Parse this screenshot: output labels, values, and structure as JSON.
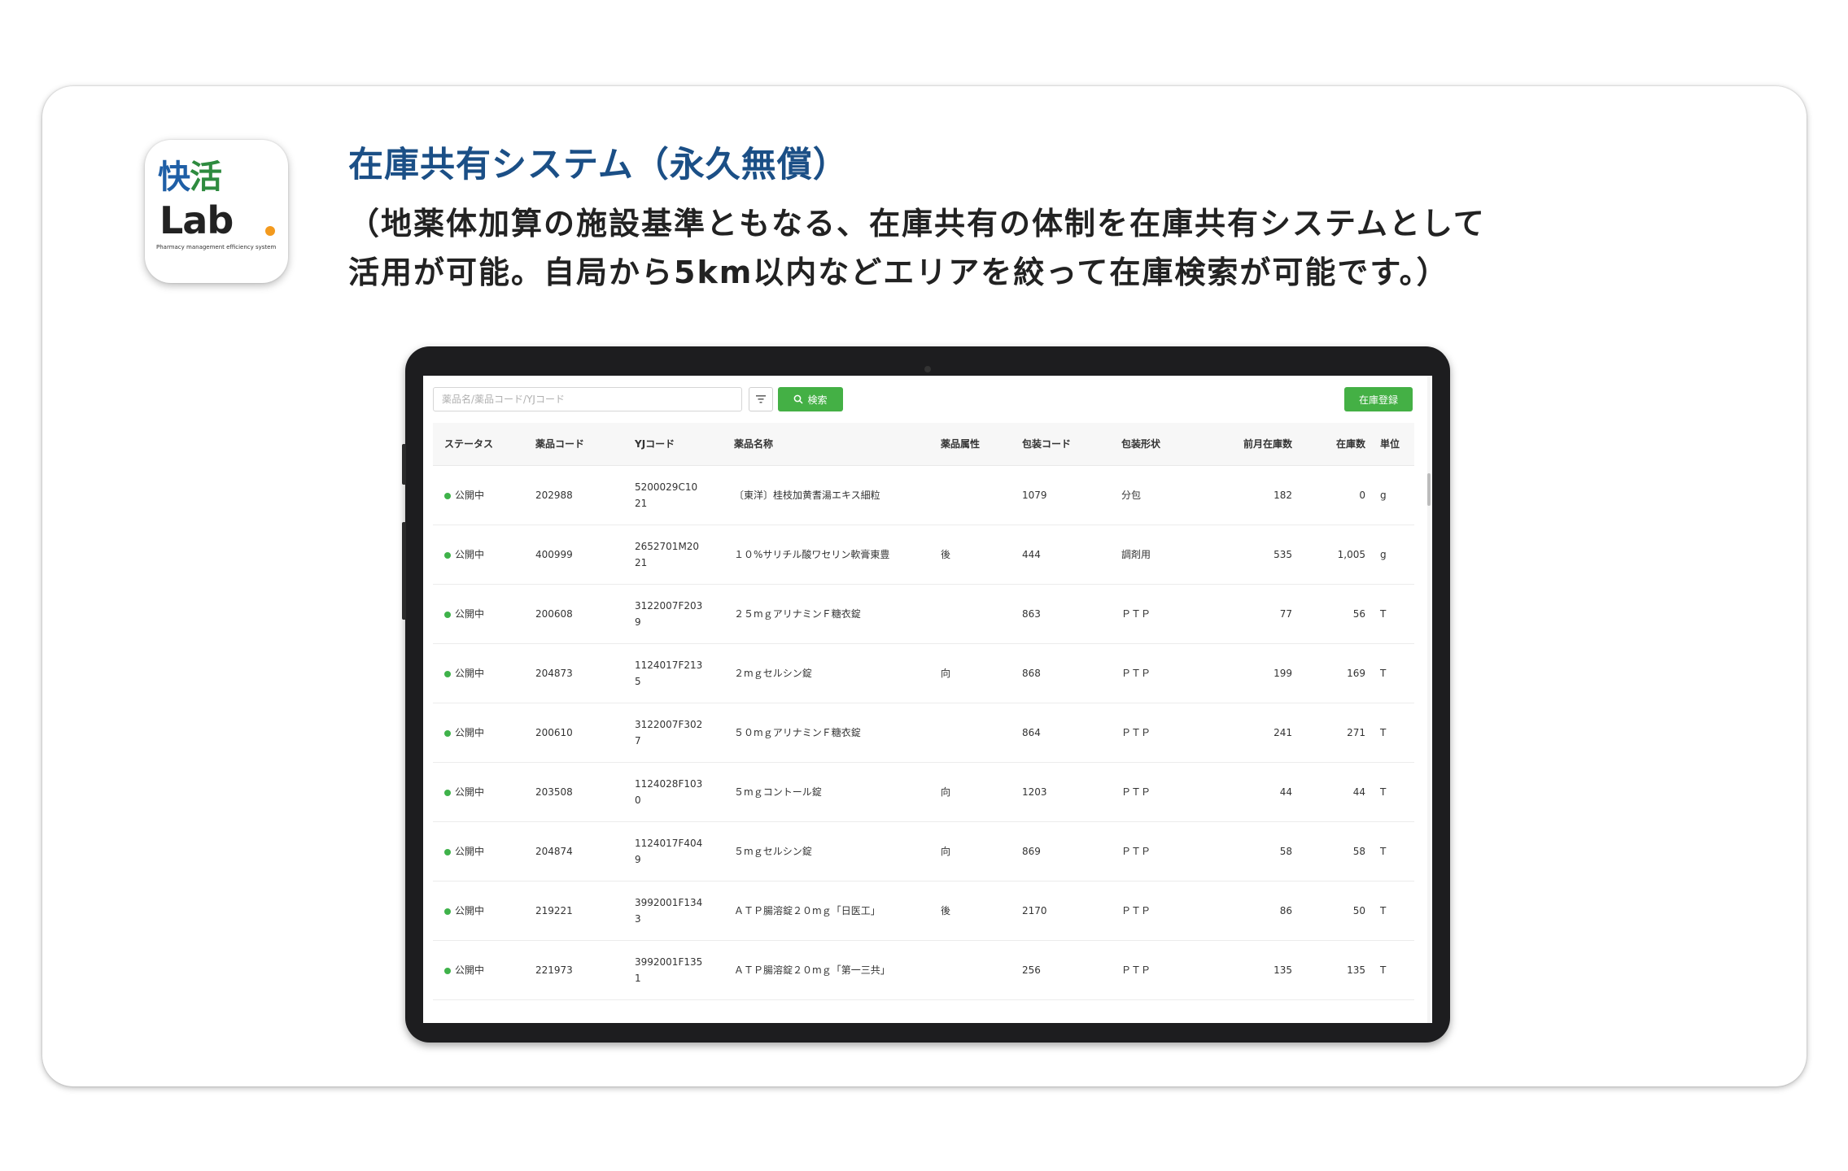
{
  "app": {
    "logo_kana_1": "快",
    "logo_kana_2": "活",
    "logo_lab": "Lab",
    "logo_tagline": "Pharmacy management efficiency system",
    "brand_colors": {
      "blue": "#1f5fa6",
      "green": "#2e8b3f",
      "orange": "#f39a1e"
    }
  },
  "heading": {
    "title": "在庫共有システム（永久無償）",
    "desc_line1": "（地薬体加算の施設基準ともなる、在庫共有の体制を在庫共有システムとして",
    "desc_line2": "活用が可能。自局から5km以内などエリアを絞って在庫検索が可能です。）"
  },
  "toolbar": {
    "search_placeholder": "薬品名/薬品コード/YJコード",
    "filter_icon": "filter-icon",
    "search_icon": "search-icon",
    "search_label": "検索",
    "register_label": "在庫登録",
    "accent_color": "#44b045"
  },
  "table": {
    "columns": [
      "ステータス",
      "薬品コード",
      "YJコード",
      "薬品名称",
      "薬品属性",
      "包装コード",
      "包装形状",
      "前月在庫数",
      "在庫数",
      "単位"
    ],
    "rows": [
      {
        "status": "公開中",
        "code": "202988",
        "yj1": "5200029C10",
        "yj2": "21",
        "name": "〔東洋〕桂枝加黄耆湯エキス細粒",
        "attr": "",
        "pack_code": "1079",
        "pack_form": "分包",
        "prev_stock": "182",
        "stock": "0",
        "unit": "g"
      },
      {
        "status": "公開中",
        "code": "400999",
        "yj1": "2652701M20",
        "yj2": "21",
        "name": "１０%サリチル酸ワセリン軟膏東豊",
        "attr": "後",
        "pack_code": "444",
        "pack_form": "調剤用",
        "prev_stock": "535",
        "stock": "1,005",
        "unit": "g"
      },
      {
        "status": "公開中",
        "code": "200608",
        "yj1": "3122007F203",
        "yj2": "9",
        "name": "２５mｇアリナミンＦ糖衣錠",
        "attr": "",
        "pack_code": "863",
        "pack_form": "ＰＴＰ",
        "prev_stock": "77",
        "stock": "56",
        "unit": "T"
      },
      {
        "status": "公開中",
        "code": "204873",
        "yj1": "1124017F213",
        "yj2": "5",
        "name": "２mｇセルシン錠",
        "attr": "向",
        "pack_code": "868",
        "pack_form": "ＰＴＰ",
        "prev_stock": "199",
        "stock": "169",
        "unit": "T"
      },
      {
        "status": "公開中",
        "code": "200610",
        "yj1": "3122007F302",
        "yj2": "7",
        "name": "５０mｇアリナミンＦ糖衣錠",
        "attr": "",
        "pack_code": "864",
        "pack_form": "ＰＴＰ",
        "prev_stock": "241",
        "stock": "271",
        "unit": "T"
      },
      {
        "status": "公開中",
        "code": "203508",
        "yj1": "1124028F103",
        "yj2": "0",
        "name": "５mｇコントール錠",
        "attr": "向",
        "pack_code": "1203",
        "pack_form": "ＰＴＰ",
        "prev_stock": "44",
        "stock": "44",
        "unit": "T"
      },
      {
        "status": "公開中",
        "code": "204874",
        "yj1": "1124017F404",
        "yj2": "9",
        "name": "５mｇセルシン錠",
        "attr": "向",
        "pack_code": "869",
        "pack_form": "ＰＴＰ",
        "prev_stock": "58",
        "stock": "58",
        "unit": "T"
      },
      {
        "status": "公開中",
        "code": "219221",
        "yj1": "3992001F134",
        "yj2": "3",
        "name": "ＡＴＰ腸溶錠２０mｇ「日医工」",
        "attr": "後",
        "pack_code": "2170",
        "pack_form": "ＰＴＰ",
        "prev_stock": "86",
        "stock": "50",
        "unit": "T"
      },
      {
        "status": "公開中",
        "code": "221973",
        "yj1": "3992001F135",
        "yj2": "1",
        "name": "ＡＴＰ腸溶錠２０mｇ「第一三共」",
        "attr": "",
        "pack_code": "256",
        "pack_form": "ＰＴＰ",
        "prev_stock": "135",
        "stock": "135",
        "unit": "T"
      }
    ]
  }
}
